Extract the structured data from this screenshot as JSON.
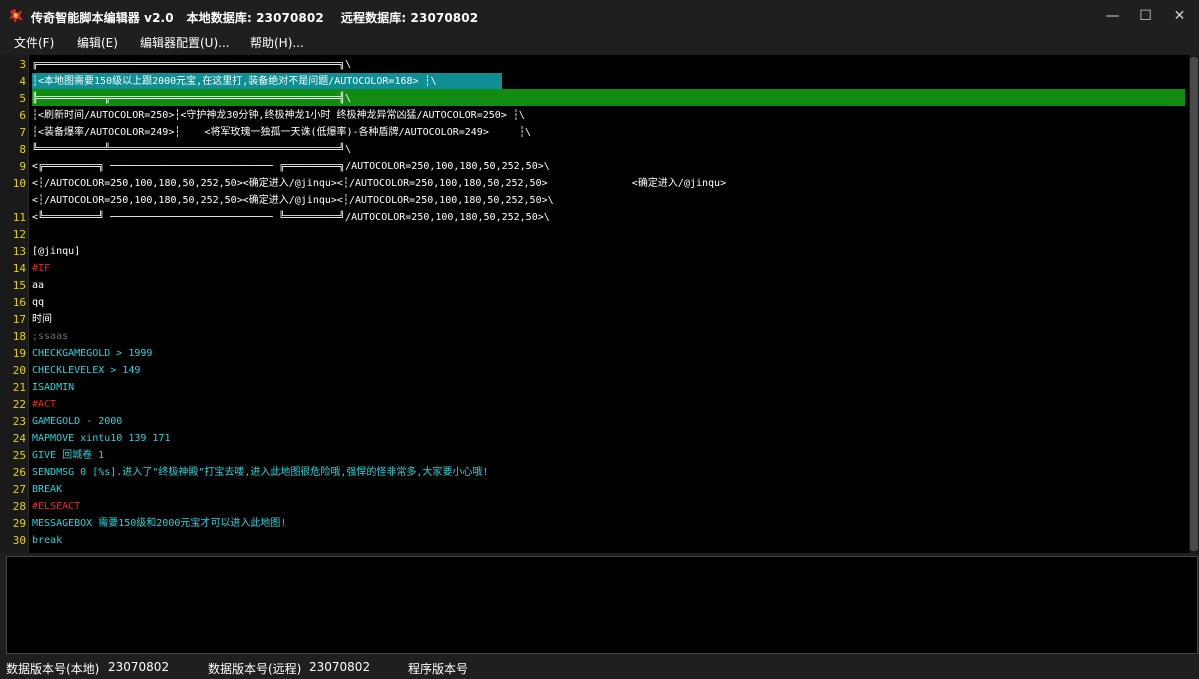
{
  "window": {
    "title": "传奇智能脚本编辑器 v2.0   本地数据库: 23070802    远程数据库: 23070802",
    "minimize_glyph": "—",
    "maximize_glyph": "☐",
    "close_glyph": "✕"
  },
  "menu": {
    "items": [
      "文件(F)",
      "编辑(E)",
      "编辑器配置(U)...",
      "帮助(H)..."
    ]
  },
  "editor": {
    "line_numbers": [
      "3",
      "4",
      "5",
      "6",
      "7",
      "8",
      "9",
      "10",
      "",
      "11",
      "12",
      "13",
      "14",
      "15",
      "16",
      "17",
      "18",
      "19",
      "20",
      "21",
      "22",
      "23",
      "24",
      "25",
      "26",
      "27",
      "28",
      "29",
      "30"
    ],
    "lines": [
      {
        "text": "╔══════════════════════════════════════════════════╗\\",
        "color": "white"
      },
      {
        "text": "┆<本地图需要150级以上跟2000元宝,在这里打,装备绝对不是问题/AUTOCOLOR=168> ┆\\",
        "color": "white"
      },
      {
        "text": "╠═══════════╦══════════════════════════════════════╣\\",
        "color": "white"
      },
      {
        "text": "┆<刷新时间/AUTOCOLOR=250>┆<守护神龙30分钟,终极神龙1小时 终极神龙异常凶猛/AUTOCOLOR=250> ┆\\",
        "color": "white"
      },
      {
        "text": "┆<装备爆率/AUTOCOLOR=249>┆    <将军玫瑰一独孤一天诛(低爆率)-各种盾牌/AUTOCOLOR=249>     ┆\\",
        "color": "white"
      },
      {
        "text": "╚═══════════╩══════════════════════════════════════╝\\",
        "color": "white"
      },
      {
        "text": "<╔═════════╗ ─────────────────────────── ╔═════════╗/AUTOCOLOR=250,100,180,50,252,50>\\",
        "color": "white"
      },
      {
        "text": "<┆/AUTOCOLOR=250,100,180,50,252,50><确定进入/@jinqu><┆/AUTOCOLOR=250,100,180,50,252,50>              <确定进入/@jinqu>",
        "color": "white"
      },
      {
        "text": "<┆/AUTOCOLOR=250,100,180,50,252,50><确定进入/@jinqu><┆/AUTOCOLOR=250,100,180,50,252,50>\\",
        "color": "white"
      },
      {
        "text": "<╚═════════╝ ─────────────────────────── ╚═════════╝/AUTOCOLOR=250,100,180,50,252,50>\\",
        "color": "white"
      },
      {
        "text": "",
        "color": "white"
      },
      {
        "text": "[@jinqu]",
        "color": "white"
      },
      {
        "text": "#IF",
        "color": "red"
      },
      {
        "text": "aa",
        "color": "white"
      },
      {
        "text": "qq",
        "color": "white"
      },
      {
        "text": "时间",
        "color": "white"
      },
      {
        "text": ";ssaas",
        "color": "gray"
      },
      {
        "text": "CHECKGAMEGOLD > 1999",
        "color": "cyan"
      },
      {
        "text": "CHECKLEVELEX > 149",
        "color": "cyan"
      },
      {
        "text": "ISADMIN",
        "color": "cyan"
      },
      {
        "text": "#ACT",
        "color": "red"
      },
      {
        "text": "GAMEGOLD - 2000",
        "color": "cyan"
      },
      {
        "text": "MAPMOVE xintu10 139 171",
        "color": "cyan"
      },
      {
        "text": "GIVE 回城卷 1",
        "color": "cyan"
      },
      {
        "text": "SENDMSG 0 [%s].进入了\"终极神殿\"打宝去喽,进入此地图很危险哦,强悍的怪非常多,大家要小心哦!",
        "color": "cyan"
      },
      {
        "text": "BREAK",
        "color": "cyan"
      },
      {
        "text": "#ELSEACT",
        "color": "red"
      },
      {
        "text": "MESSAGEBOX 需要150级和2000元宝才可以进入此地图!",
        "color": "cyan"
      },
      {
        "text": "break",
        "color": "cyan"
      }
    ]
  },
  "status": {
    "local_label": "数据版本号(本地)",
    "local_value": "23070802",
    "remote_label": "数据版本号(远程)",
    "remote_value": "23070802",
    "program_label": "程序版本号"
  },
  "colors": {
    "bg": "#1f1f1f",
    "editor_bg": "#000000",
    "line_number": "#e6d400",
    "selection": "#0f8f93",
    "current_line": "#128b12",
    "keyword_red": "#ff2020",
    "command_cyan": "#22d6e0"
  }
}
